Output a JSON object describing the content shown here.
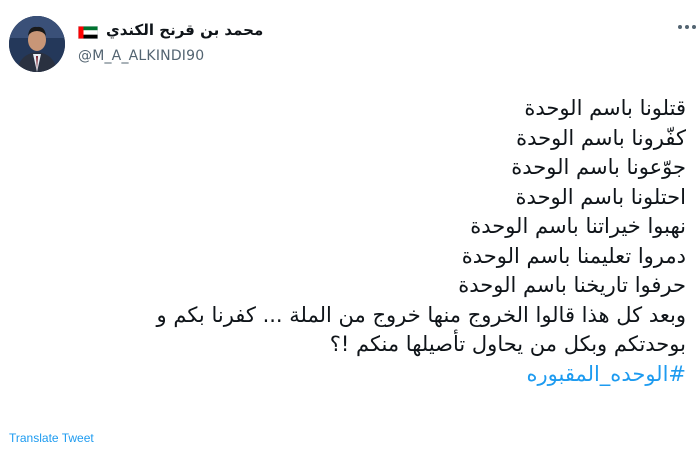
{
  "author": {
    "display_name": "محمد بن قرنح الكندي",
    "handle": "@M_A_ALKINDI90",
    "flag_icon": "uae-flag-icon",
    "avatar_icon": "profile-avatar"
  },
  "menu": {
    "icon": "more-dots-icon"
  },
  "tweet": {
    "lines": [
      "قتلونا باسم الوحدة",
      "كفّرونا باسم الوحدة",
      "جوّعونا باسم الوحدة",
      "احتلونا باسم الوحدة",
      "نهبوا خيراتنا باسم الوحدة",
      "دمروا تعليمنا باسم الوحدة",
      "حرفوا تاريخنا باسم الوحدة",
      "وبعد كل هذا قالوا الخروج منها خروج من الملة ... كفرنا بكم و",
      "بوحدتكم وبكل من يحاول تأصيلها منكم !؟"
    ],
    "hashtag": "#الوحده_المقبوره"
  },
  "translate_label": "Translate Tweet",
  "colors": {
    "link": "#1d9bf0",
    "secondary_text": "#536471"
  }
}
